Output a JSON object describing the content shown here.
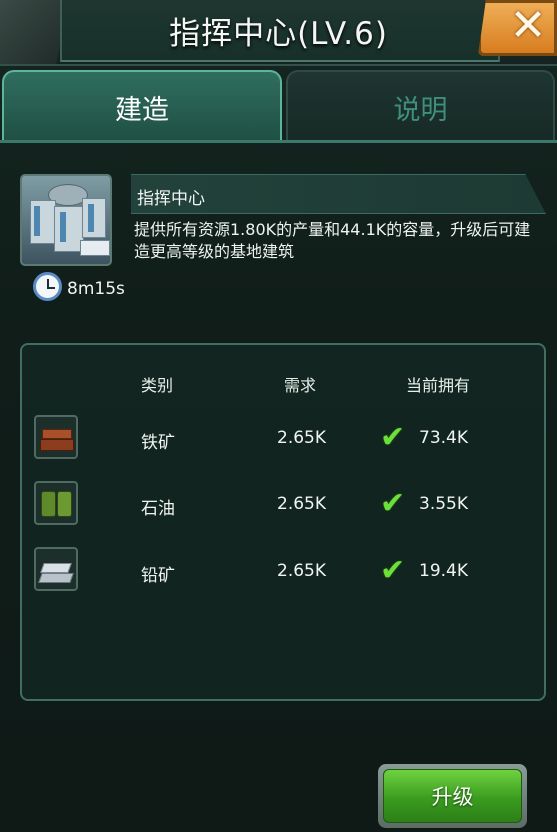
{
  "window": {
    "title": "指挥中心(LV.6)",
    "close_icon": "close-x-icon"
  },
  "tabs": [
    {
      "label": "建造",
      "active": true
    },
    {
      "label": "说明",
      "active": false
    }
  ],
  "building": {
    "name": "指挥中心",
    "description": "提供所有资源1.80K的产量和44.1K的容量，升级后可建造更高等级的基地建筑",
    "build_time": "8m15s",
    "thumbnail_icon": "command-center-building-icon",
    "timer_icon": "clock-icon"
  },
  "resources": {
    "headers": {
      "type": "类别",
      "required": "需求",
      "owned": "当前拥有"
    },
    "rows": [
      {
        "icon": "iron-ore-icon",
        "name": "铁矿",
        "required": "2.65K",
        "owned": "73.4K",
        "satisfied": true
      },
      {
        "icon": "oil-barrel-icon",
        "name": "石油",
        "required": "2.65K",
        "owned": "3.55K",
        "satisfied": true
      },
      {
        "icon": "lead-ingot-icon",
        "name": "铅矿",
        "required": "2.65K",
        "owned": "19.4K",
        "satisfied": true
      }
    ]
  },
  "actions": {
    "upgrade_label": "升级"
  },
  "colors": {
    "accent_green": "#3a9c1f",
    "check_green": "#6ddf3a",
    "close_orange": "#d67a1c",
    "panel_border": "#3f6f63"
  }
}
